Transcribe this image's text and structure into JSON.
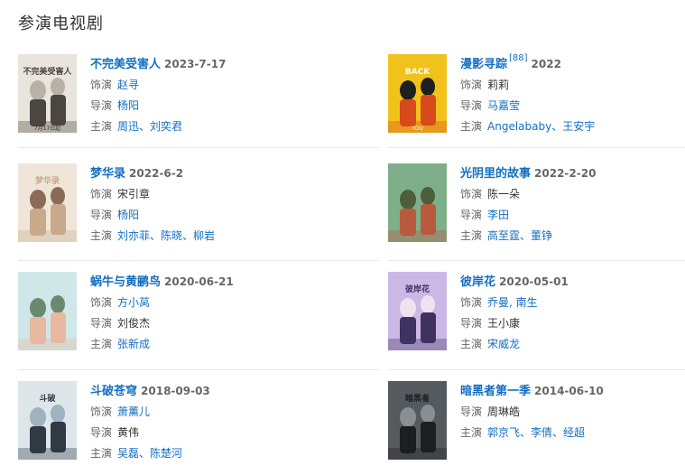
{
  "section": {
    "title": "参演电视剧"
  },
  "items": [
    {
      "title": "不完美受害人",
      "ref": "",
      "date": "2023-7-17",
      "rows": [
        {
          "label": "饰演",
          "value": "赵寻",
          "link": true
        },
        {
          "label": "导演",
          "value": "杨阳",
          "link": true
        },
        {
          "label": "主演",
          "value": "周迅、刘奕君",
          "link": true
        }
      ],
      "poster_caption": "不完美受害人",
      "poster_sub": "7月17日起",
      "poster_colors": [
        "#e9e4dc",
        "#4a4642",
        "#b8b1a6"
      ]
    },
    {
      "title": "漫影寻踪",
      "ref": "[88]",
      "date": "2022",
      "rows": [
        {
          "label": "饰演",
          "value": "莉莉",
          "link": false
        },
        {
          "label": "导演",
          "value": "马嘉莹",
          "link": true
        },
        {
          "label": "主演",
          "value": "Angelababy、王安宇",
          "link": true
        }
      ],
      "poster_caption": "BACK",
      "poster_sub": "YOU",
      "poster_colors": [
        "#f1c21b",
        "#d84a1c",
        "#1f1f1f"
      ]
    },
    {
      "title": "梦华录",
      "ref": "",
      "date": "2022-6-2",
      "rows": [
        {
          "label": "饰演",
          "value": "宋引章",
          "link": false
        },
        {
          "label": "导演",
          "value": "杨阳",
          "link": true
        },
        {
          "label": "主演",
          "value": "刘亦菲、陈晓、柳岩",
          "link": true
        }
      ],
      "poster_caption": "梦华录",
      "poster_sub": "",
      "poster_colors": [
        "#efe6d9",
        "#c9a98c",
        "#8c6a58"
      ]
    },
    {
      "title": "光阴里的故事",
      "ref": "",
      "date": "2022-2-20",
      "rows": [
        {
          "label": "饰演",
          "value": "陈一朵",
          "link": false
        },
        {
          "label": "导演",
          "value": "李田",
          "link": true
        },
        {
          "label": "主演",
          "value": "高至霆、董铮",
          "link": true
        }
      ],
      "poster_caption": "",
      "poster_sub": "",
      "poster_colors": [
        "#7fae8b",
        "#b85a3e",
        "#4a5f3a"
      ]
    },
    {
      "title": "蜗牛与黄鹂鸟",
      "ref": "",
      "date": "2020-06-21",
      "rows": [
        {
          "label": "饰演",
          "value": "方小莴",
          "link": true
        },
        {
          "label": "导演",
          "value": "刘俊杰",
          "link": false
        },
        {
          "label": "主演",
          "value": "张新成",
          "link": true
        }
      ],
      "poster_caption": "",
      "poster_sub": "",
      "poster_colors": [
        "#cfe7e9",
        "#e8b9a0",
        "#6a8a6f"
      ]
    },
    {
      "title": "彼岸花",
      "ref": "",
      "date": "2020-05-01",
      "rows": [
        {
          "label": "饰演",
          "value": "乔曼, 南生",
          "link": true
        },
        {
          "label": "导演",
          "value": "王小康",
          "link": false
        },
        {
          "label": "主演",
          "value": "宋威龙",
          "link": true
        }
      ],
      "poster_caption": "彼岸花",
      "poster_sub": "",
      "poster_colors": [
        "#cbb8e6",
        "#3e3360",
        "#f0e2f1"
      ]
    },
    {
      "title": "斗破苍穹",
      "ref": "",
      "date": "2018-09-03",
      "rows": [
        {
          "label": "饰演",
          "value": "萧薰儿",
          "link": true
        },
        {
          "label": "导演",
          "value": "黄伟",
          "link": false
        },
        {
          "label": "主演",
          "value": "吴磊、陈楚河",
          "link": true
        }
      ],
      "poster_caption": "斗破",
      "poster_sub": "",
      "poster_colors": [
        "#dfe6ea",
        "#2f3a44",
        "#9fb2c0"
      ]
    },
    {
      "title": "暗黑者第一季",
      "ref": "",
      "date": "2014-06-10",
      "rows": [
        {
          "label": "导演",
          "value": "周琳皓",
          "link": false
        },
        {
          "label": "主演",
          "value": "郭京飞、李倩、经超",
          "link": true
        }
      ],
      "poster_caption": "暗黑者",
      "poster_sub": "",
      "poster_colors": [
        "#555a5e",
        "#1c1e20",
        "#8a8f93"
      ]
    }
  ]
}
